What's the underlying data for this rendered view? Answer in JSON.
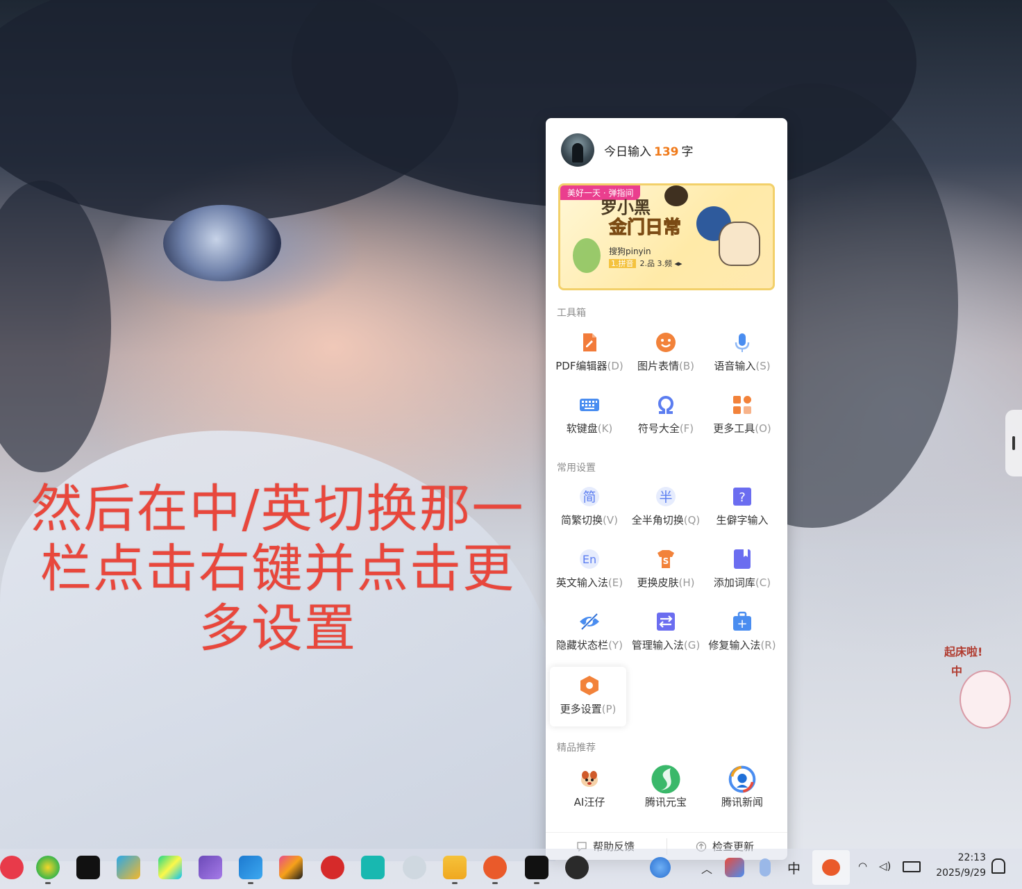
{
  "annotation": {
    "line1": "然后在中/英切换那一",
    "line2": "栏点击右键并点击更",
    "line3": "多设置"
  },
  "panel": {
    "today_prefix": "今日输入",
    "today_count": "139",
    "today_unit": "字",
    "banner": {
      "tag": "美好一天 · 弹指间",
      "title": "罗小黑",
      "subtitle": "金门日常",
      "brand": "搜狗pinyin",
      "candidates_first": "1.拼音",
      "candidates_rest": "2.品  3.频  ◂▸"
    },
    "toolbox": {
      "title": "工具箱",
      "items": [
        {
          "label": "PDF编辑器",
          "key": "(D)",
          "icon": "pdf-editor-icon",
          "color": "#f27b3a"
        },
        {
          "label": "图片表情",
          "key": "(B)",
          "icon": "emoji-icon",
          "color": "#f2823a"
        },
        {
          "label": "语音输入",
          "key": "(S)",
          "icon": "microphone-icon",
          "color": "#4a8df0"
        },
        {
          "label": "软键盘",
          "key": "(K)",
          "icon": "keyboard-icon",
          "color": "#4a8df0"
        },
        {
          "label": "符号大全",
          "key": "(F)",
          "icon": "omega-icon",
          "color": "#5b7df0"
        },
        {
          "label": "更多工具",
          "key": "(O)",
          "icon": "grid-icon",
          "color": "#f2823a"
        }
      ]
    },
    "settings": {
      "title": "常用设置",
      "items": [
        {
          "label": "简繁切换",
          "key": "(V)",
          "icon": "simplified-traditional-icon",
          "glyph": "简",
          "color": "#5b7df0"
        },
        {
          "label": "全半角切换",
          "key": "(Q)",
          "icon": "half-width-icon",
          "glyph": "半",
          "color": "#5b7df0"
        },
        {
          "label": "生僻字输入",
          "key": "",
          "icon": "rare-char-icon",
          "glyph": "?",
          "color": "#6b6df0"
        },
        {
          "label": "英文输入法",
          "key": "(E)",
          "icon": "english-icon",
          "glyph": "En",
          "color": "#5b7df0"
        },
        {
          "label": "更换皮肤",
          "key": "(H)",
          "icon": "skin-icon",
          "glyph": "S",
          "color": "#f2823a"
        },
        {
          "label": "添加词库",
          "key": "(C)",
          "icon": "dictionary-icon",
          "glyph": "",
          "color": "#6b6df0"
        },
        {
          "label": "隐藏状态栏",
          "key": "(Y)",
          "icon": "hide-eye-icon",
          "glyph": "",
          "color": "#4a8df0"
        },
        {
          "label": "管理输入法",
          "key": "(G)",
          "icon": "manage-icon",
          "glyph": "",
          "color": "#6b6df0"
        },
        {
          "label": "修复输入法",
          "key": "(R)",
          "icon": "repair-kit-icon",
          "glyph": "+",
          "color": "#4a8df0"
        },
        {
          "label": "更多设置",
          "key": "(P)",
          "icon": "settings-hexagon-icon",
          "glyph": "",
          "color": "#f2823a"
        }
      ]
    },
    "recommend": {
      "title": "精品推荐",
      "items": [
        {
          "label": "AI汪仔",
          "icon": "ai-dog-icon"
        },
        {
          "label": "腾讯元宝",
          "icon": "yuanbao-icon"
        },
        {
          "label": "腾讯新闻",
          "icon": "tencent-news-icon"
        }
      ]
    },
    "footer": {
      "help": "帮助反馈",
      "update": "检查更新"
    }
  },
  "taskbar": {
    "time": "22:13",
    "date": "2025/9/29",
    "ime_indicator": "中"
  },
  "sticker": {
    "text1": "起床啦!",
    "text2": "中"
  }
}
